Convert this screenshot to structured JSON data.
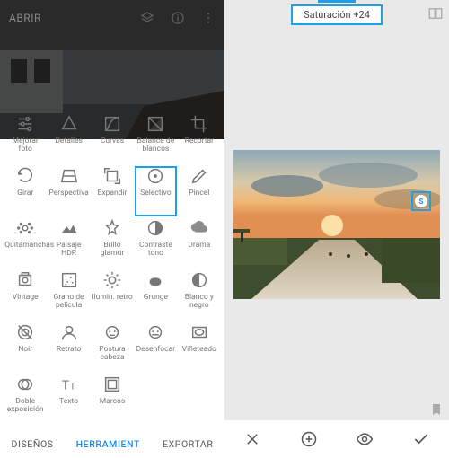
{
  "left": {
    "open_label": "ABRIR",
    "tabs": {
      "designs": "DISEÑOS",
      "tools": "HERRAMIENT",
      "export": "EXPORTAR"
    },
    "active_tab": "tools"
  },
  "tools": [
    {
      "id": "tune",
      "label": "Mejorar foto"
    },
    {
      "id": "details",
      "label": "Detalles"
    },
    {
      "id": "curves",
      "label": "Curvas"
    },
    {
      "id": "wb",
      "label": "Balance de blancos"
    },
    {
      "id": "crop",
      "label": "Recortar"
    },
    {
      "id": "rotate",
      "label": "Girar"
    },
    {
      "id": "persp",
      "label": "Perspectiva"
    },
    {
      "id": "expand",
      "label": "Expandir"
    },
    {
      "id": "selective",
      "label": "Selectivo",
      "selected": true
    },
    {
      "id": "brush",
      "label": "Pincel"
    },
    {
      "id": "healing",
      "label": "Quitamanchas"
    },
    {
      "id": "hdr",
      "label": "Paisaje HDR"
    },
    {
      "id": "glamour",
      "label": "Brillo glamur"
    },
    {
      "id": "tonal",
      "label": "Contraste tono"
    },
    {
      "id": "drama",
      "label": "Drama"
    },
    {
      "id": "vintage",
      "label": "Vintage"
    },
    {
      "id": "grain",
      "label": "Grano de película"
    },
    {
      "id": "retrolux",
      "label": "Ilumin. retro"
    },
    {
      "id": "grunge",
      "label": "Grunge"
    },
    {
      "id": "bw",
      "label": "Blanco y negro"
    },
    {
      "id": "noir",
      "label": "Noir"
    },
    {
      "id": "portrait",
      "label": "Retrato"
    },
    {
      "id": "headpose",
      "label": "Postura cabeza"
    },
    {
      "id": "blur",
      "label": "Desenfocar"
    },
    {
      "id": "vignette",
      "label": "Viñeteado"
    },
    {
      "id": "dblexp",
      "label": "Doble exposición"
    },
    {
      "id": "text",
      "label": "Texto"
    },
    {
      "id": "frames",
      "label": "Marcos"
    }
  ],
  "right": {
    "adjustment_label": "Saturación +24",
    "control_point_letter": "S"
  }
}
